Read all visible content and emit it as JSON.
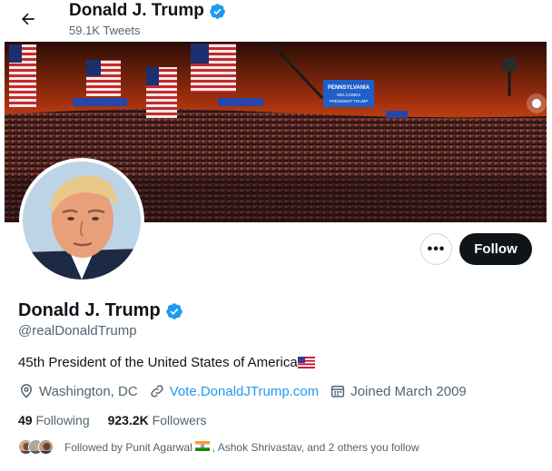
{
  "header": {
    "name": "Donald J. Trump",
    "tweet_count": "59.1K Tweets"
  },
  "banner": {
    "signs": [
      "PENNSYLVANIA",
      "WELCOMES",
      "PRESIDENT TRUMP"
    ]
  },
  "actions": {
    "more_label": "•••",
    "follow_label": "Follow"
  },
  "profile": {
    "name": "Donald J. Trump",
    "handle": "@realDonaldTrump",
    "bio": "45th President of the United States of America",
    "location": "Washington, DC",
    "website": "Vote.DonaldJTrump.com",
    "joined": "Joined March 2009"
  },
  "stats": {
    "following_count": "49",
    "following_label": "Following",
    "followers_count": "923.2K",
    "followers_label": "Followers"
  },
  "followed_by": {
    "prefix": "Followed by Punit Agarwal",
    "suffix": ", Ashok Shrivastav, and 2 others you follow"
  },
  "icons": {
    "back": "arrow-left-icon",
    "verified": "verified-badge-icon",
    "location": "location-pin-icon",
    "link": "link-icon",
    "calendar": "calendar-icon",
    "us_flag": "us-flag-icon",
    "india_flag": "india-flag-icon"
  },
  "colors": {
    "accent": "#1d9bf0",
    "follow_button": "#0f1419",
    "secondary_text": "#536471"
  }
}
